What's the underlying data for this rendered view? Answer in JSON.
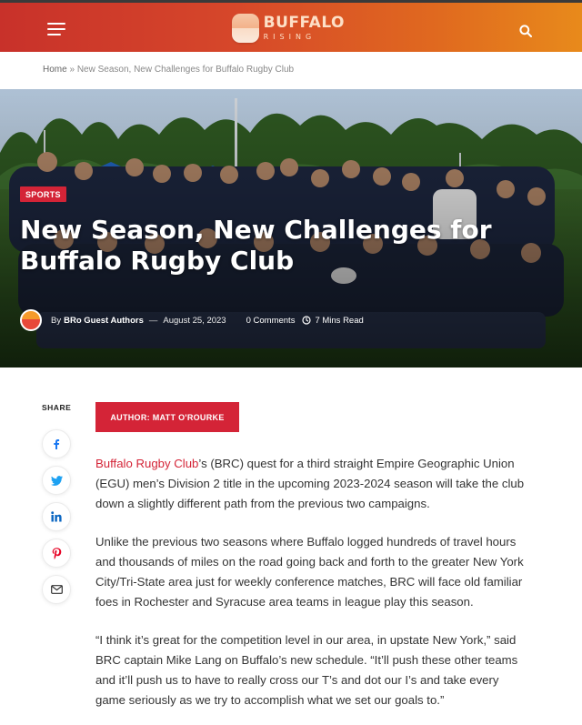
{
  "header": {
    "logo_word1": "BUFFALO",
    "logo_word2": "RISING",
    "menu_icon": "hamburger-menu-icon",
    "search_icon": "search-icon",
    "gradient_colors": [
      "#c8312a",
      "#e88a1b"
    ]
  },
  "breadcrumb": {
    "home": "Home",
    "separator": "»",
    "current": "New Season, New Challenges for Buffalo Rugby Club"
  },
  "hero": {
    "tag": "SPORTS",
    "title": "New Season, New Challenges for Buffalo Rugby Club",
    "by": "By",
    "author": "BRo Guest Authors",
    "dash": "—",
    "date": "August 25, 2023",
    "comments": "0 Comments",
    "read_time": "7 Mins Read"
  },
  "share": {
    "label": "SHARE",
    "buttons": [
      "facebook-icon",
      "twitter-icon",
      "linkedin-icon",
      "pinterest-icon",
      "email-icon"
    ]
  },
  "author_box": {
    "label": "AUTHOR: MATT O'ROURKE"
  },
  "article": {
    "p1_link": "Buffalo Rugby Club",
    "p1_rest": "’s (BRC) quest for a third straight Empire Geographic Union (EGU) men’s Division 2 title in the upcoming 2023-2024 season will take the club down a slightly different path from the previous two campaigns.",
    "p2": "Unlike the previous two seasons where Buffalo logged hundreds of travel hours and thousands of miles on the road going back and forth to the greater New York City/Tri-State area just for weekly conference matches, BRC will face old familiar foes in Rochester and Syracuse area teams in league play this season.",
    "p3": "“I think it’s great for the competition level in our area, in upstate New York,” said BRC captain Mike Lang on Buffalo’s new schedule. “It’ll push these other teams and it’ll push us to have to really cross our T’s and dot our I’s and take every game seriously as we try to accomplish what we set our goals to.”"
  },
  "colors": {
    "accent": "#d42437",
    "text": "#333333"
  }
}
